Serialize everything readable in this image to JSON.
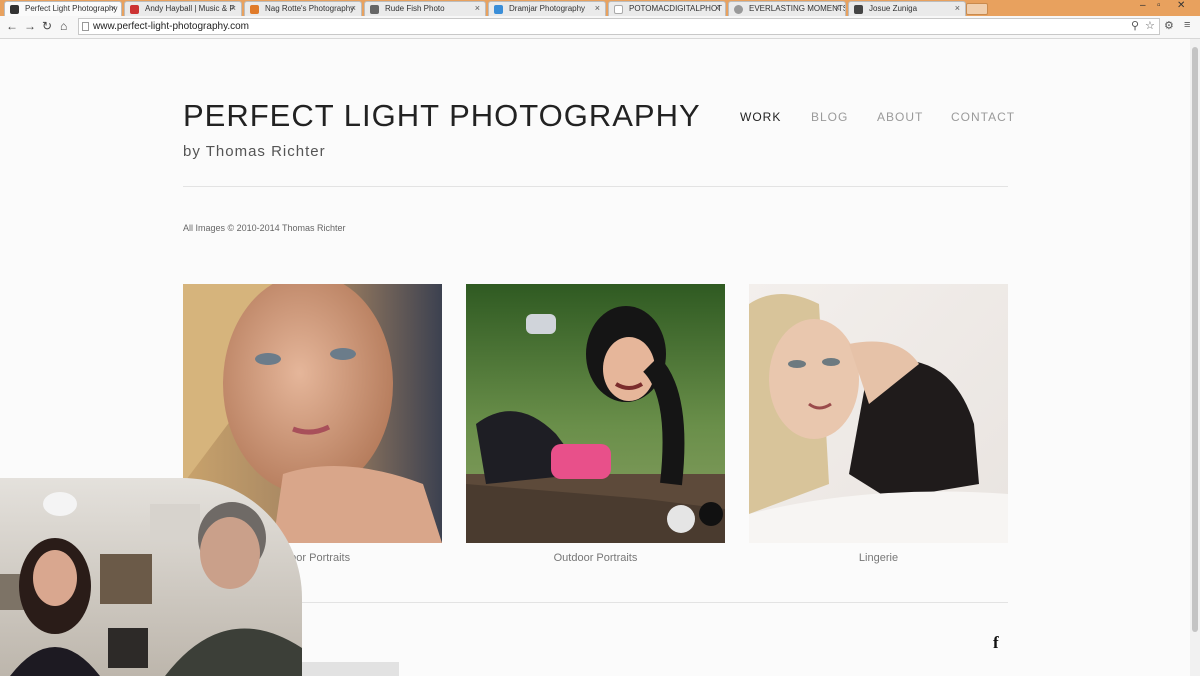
{
  "browser": {
    "tabs": [
      {
        "title": "Perfect Light Photography"
      },
      {
        "title": "Andy Hayball | Music & P"
      },
      {
        "title": "Nag Rotte's Photography"
      },
      {
        "title": "Rude Fish Photo"
      },
      {
        "title": "Dramjar Photography"
      },
      {
        "title": "POTOMACDIGITALPHOT"
      },
      {
        "title": "EVERLASTING MOMENTS"
      },
      {
        "title": "Josue Zuniga"
      }
    ],
    "url": "www.perfect-light-photography.com"
  },
  "site": {
    "title": "PERFECT LIGHT PHOTOGRAPHY",
    "subtitle": "by Thomas Richter",
    "nav": [
      "WORK",
      "BLOG",
      "ABOUT",
      "CONTACT"
    ],
    "copyright": "All Images © 2010-2014 Thomas Richter",
    "galleries": [
      {
        "caption": "Indoor Portraits"
      },
      {
        "caption": "Outdoor Portraits"
      },
      {
        "caption": "Lingerie"
      }
    ],
    "social": {
      "facebook": "f"
    }
  },
  "icons": {
    "back": "back-arrow-icon",
    "forward": "forward-arrow-icon",
    "reload": "reload-icon",
    "home": "home-icon",
    "zoom": "zoom-icon",
    "star": "star-icon",
    "menu": "menu-icon",
    "facebook": "facebook-icon"
  },
  "colors": {
    "tab_strip": "#e8a15e",
    "page_bg": "#fbfbfb",
    "title": "#222222",
    "nav_inactive": "#9a9a9a"
  }
}
